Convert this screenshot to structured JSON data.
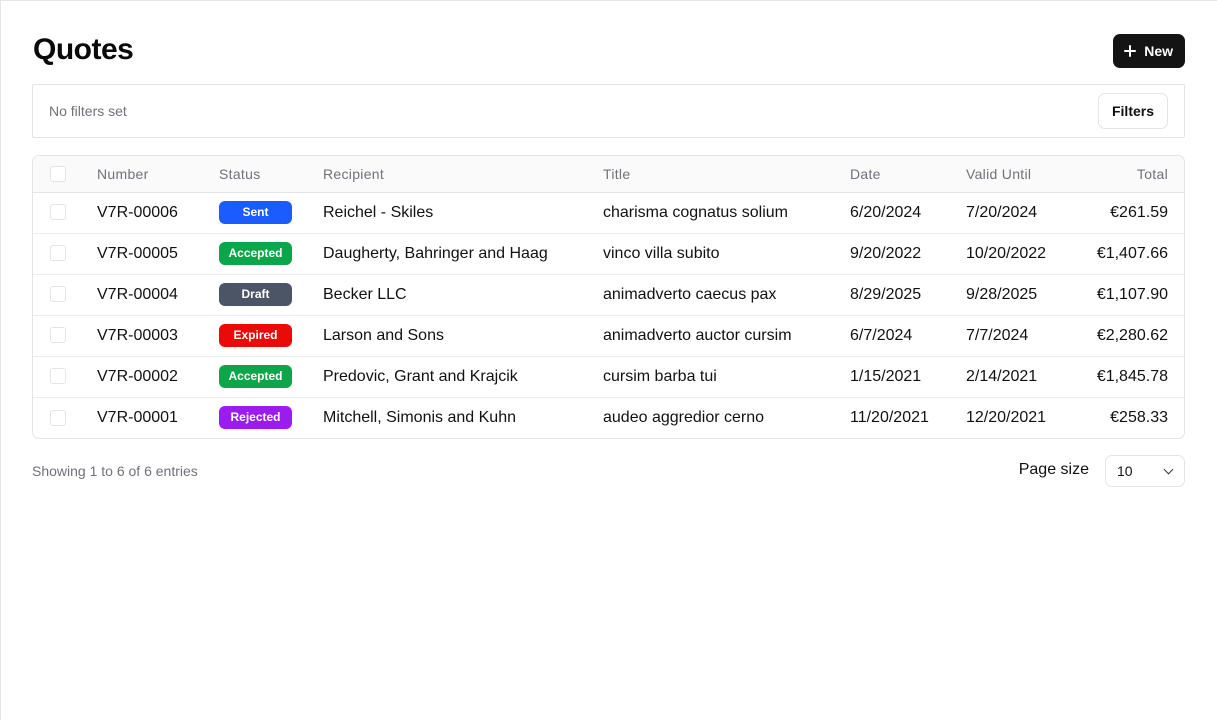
{
  "header": {
    "title": "Quotes",
    "new_label": "New"
  },
  "filters": {
    "empty_text": "No filters set",
    "button_label": "Filters"
  },
  "table": {
    "columns": [
      "Number",
      "Status",
      "Recipient",
      "Title",
      "Date",
      "Valid Until",
      "Total"
    ],
    "rows": [
      {
        "number": "V7R-00006",
        "status": "Sent",
        "recipient": "Reichel - Skiles",
        "title": "charisma cognatus solium",
        "date": "6/20/2024",
        "valid_until": "7/20/2024",
        "total": "€261.59"
      },
      {
        "number": "V7R-00005",
        "status": "Accepted",
        "recipient": "Daugherty, Bahringer and Haag",
        "title": "vinco villa subito",
        "date": "9/20/2022",
        "valid_until": "10/20/2022",
        "total": "€1,407.66"
      },
      {
        "number": "V7R-00004",
        "status": "Draft",
        "recipient": "Becker LLC",
        "title": "animadverto caecus pax",
        "date": "8/29/2025",
        "valid_until": "9/28/2025",
        "total": "€1,107.90"
      },
      {
        "number": "V7R-00003",
        "status": "Expired",
        "recipient": "Larson and Sons",
        "title": "animadverto auctor cursim",
        "date": "6/7/2024",
        "valid_until": "7/7/2024",
        "total": "€2,280.62"
      },
      {
        "number": "V7R-00002",
        "status": "Accepted",
        "recipient": "Predovic, Grant and Krajcik",
        "title": "cursim barba tui",
        "date": "1/15/2021",
        "valid_until": "2/14/2021",
        "total": "€1,845.78"
      },
      {
        "number": "V7R-00001",
        "status": "Rejected",
        "recipient": "Mitchell, Simonis and Kuhn",
        "title": "audeo aggredior cerno",
        "date": "11/20/2021",
        "valid_until": "12/20/2021",
        "total": "€258.33"
      }
    ]
  },
  "status_colors": {
    "Sent": "#1a5cff",
    "Accepted": "#0ba54a",
    "Draft": "#4b5565",
    "Expired": "#ea0a0a",
    "Rejected": "#9b1cf0"
  },
  "footer": {
    "showing_text": "Showing 1 to 6 of 6 entries",
    "page_size_label": "Page size",
    "page_size_value": "10"
  },
  "icons": {
    "new_button": "plus-icon",
    "page_size_select": "chevron-down-icon"
  }
}
